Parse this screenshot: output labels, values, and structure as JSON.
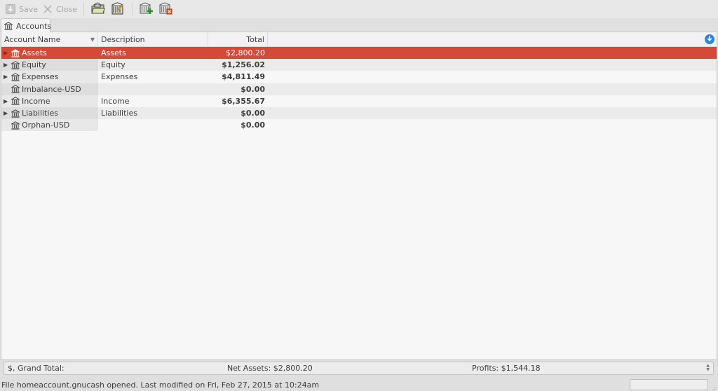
{
  "toolbar": {
    "save_label": "Save",
    "close_label": "Close",
    "icons": [
      "save-icon",
      "close-icon",
      "open-file-icon",
      "edit-account-icon",
      "new-account-icon",
      "delete-account-icon"
    ]
  },
  "tabs": [
    {
      "label": "Accounts",
      "icon": "bank-icon",
      "active": true
    }
  ],
  "table": {
    "columns": [
      {
        "label": "Account Name",
        "sort": "descending"
      },
      {
        "label": "Description"
      },
      {
        "label": "Total"
      }
    ],
    "rows": [
      {
        "name": "Assets",
        "description": "Assets",
        "total": "$2,800.20",
        "expandable": true,
        "selected": true
      },
      {
        "name": "Equity",
        "description": "Equity",
        "total": "$1,256.02",
        "expandable": true,
        "selected": false
      },
      {
        "name": "Expenses",
        "description": "Expenses",
        "total": "$4,811.49",
        "expandable": true,
        "selected": false
      },
      {
        "name": "Imbalance-USD",
        "description": "",
        "total": "$0.00",
        "expandable": false,
        "selected": false
      },
      {
        "name": "Income",
        "description": "Income",
        "total": "$6,355.67",
        "expandable": true,
        "selected": false
      },
      {
        "name": "Liabilities",
        "description": "Liabilities",
        "total": "$0.00",
        "expandable": true,
        "selected": false
      },
      {
        "name": "Orphan-USD",
        "description": "",
        "total": "$0.00",
        "expandable": false,
        "selected": false
      }
    ]
  },
  "summary": {
    "label": "$, Grand Total:",
    "net_assets": "Net Assets: $2,800.20",
    "profits": "Profits: $1,544.18"
  },
  "statusbar": {
    "message": "File homeaccount.gnucash opened. Last modified on Fri, Feb 27, 2015 at 10:24am"
  },
  "colors": {
    "selection": "#d64937",
    "column-selector": "#2d86d8"
  }
}
